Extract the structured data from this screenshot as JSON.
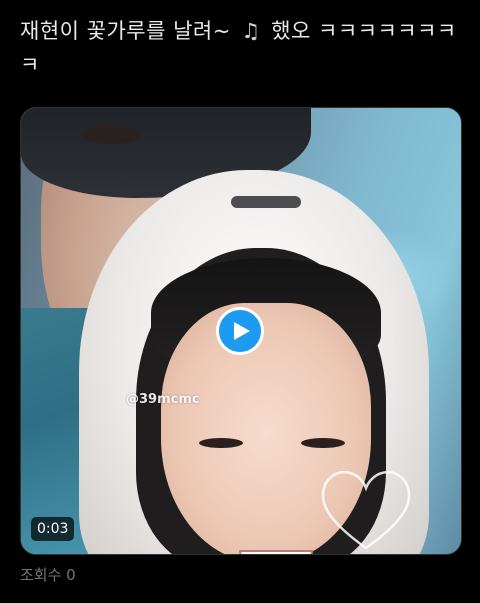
{
  "tweet": {
    "text_before_icon": "재현이 꽃가루를 날려~ ",
    "icon": "music-note-icon",
    "icon_glyph": "♫",
    "text_after_icon": " 했오 ㅋㅋㅋㅋㅋㅋㅋㅋ"
  },
  "media": {
    "watermark": "@39mcmc",
    "duration": "0:03",
    "play_icon": "play-icon",
    "accent_color": "#1d9bf0"
  },
  "footer": {
    "views": "조회수 0"
  }
}
